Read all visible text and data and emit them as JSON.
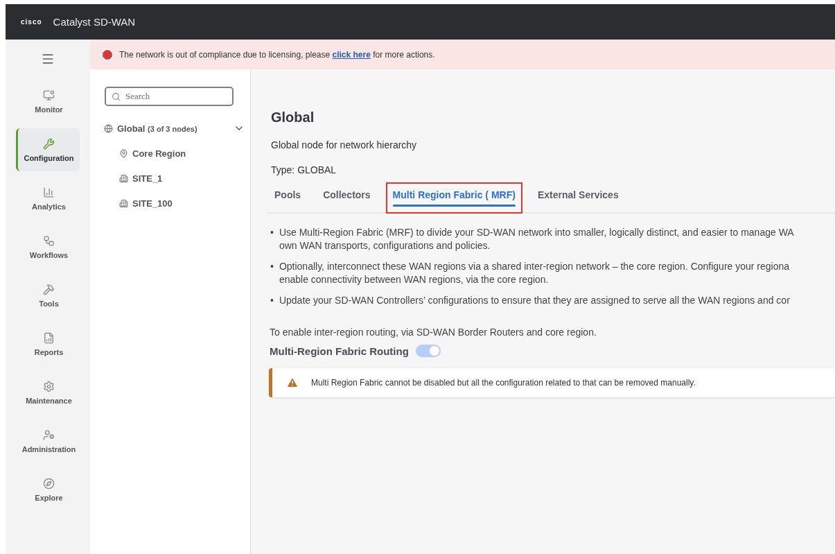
{
  "header": {
    "logo": "cisco",
    "title": "Catalyst SD-WAN"
  },
  "nav": [
    {
      "kind": "monitor",
      "label": "Monitor",
      "selected": false
    },
    {
      "kind": "configuration",
      "label": "Configuration",
      "selected": true
    },
    {
      "kind": "analytics",
      "label": "Analytics",
      "selected": false
    },
    {
      "kind": "workflows",
      "label": "Workflows",
      "selected": false
    },
    {
      "kind": "tools",
      "label": "Tools",
      "selected": false
    },
    {
      "kind": "reports",
      "label": "Reports",
      "selected": false
    },
    {
      "kind": "maintenance",
      "label": "Maintenance",
      "selected": false
    },
    {
      "kind": "administration",
      "label": "Administration",
      "selected": false
    },
    {
      "kind": "explore",
      "label": "Explore",
      "selected": false
    }
  ],
  "banner": {
    "text": "The network is out of compliance due to licensing, please ",
    "link": "click here",
    "after": " for more actions."
  },
  "tree": {
    "search": {
      "placeholder": "Search"
    },
    "root": {
      "kind": "global",
      "label": "Global",
      "count": "(3 of 3 nodes)",
      "expanded": true,
      "children": [
        {
          "kind": "region",
          "label": "Core Region"
        },
        {
          "kind": "site",
          "label": "SITE_1"
        },
        {
          "kind": "site",
          "label": "SITE_100"
        }
      ]
    }
  },
  "main": {
    "title": "Global",
    "description": "Global node for network hierarchy",
    "type": "Type: GLOBAL",
    "tabs": [
      {
        "label": "Pools",
        "selected": false,
        "highlighted": false
      },
      {
        "label": "Collectors",
        "selected": false,
        "highlighted": false
      },
      {
        "label": "Multi Region Fabric ( MRF)",
        "selected": true,
        "highlighted": true
      },
      {
        "label": "External Services",
        "selected": false,
        "highlighted": false
      }
    ],
    "bullets": [
      {
        "marker": "•",
        "lines": [
          "Use Multi-Region Fabric (MRF) to divide your SD-WAN network into smaller, logically distinct, and easier to manage WA",
          "own WAN transports, configurations and policies."
        ]
      },
      {
        "marker": "•",
        "lines": [
          "Optionally, interconnect these WAN regions via a shared inter-region network – the core region. Configure your regiona",
          "enable connectivity between WAN regions, via the core region."
        ]
      },
      {
        "marker": "•",
        "lines": [
          "Update your SD-WAN Controllers’ configurations to ensure that they are assigned to serve all the WAN regions and cor"
        ]
      }
    ],
    "routing_note": "To enable inter-region routing, via SD-WAN Border Routers and core region.",
    "toggle": {
      "label": "Multi-Region Fabric Routing",
      "on": true
    },
    "warning": "Multi Region Fabric cannot be disabled but all the configuration related to that can be removed manually."
  }
}
